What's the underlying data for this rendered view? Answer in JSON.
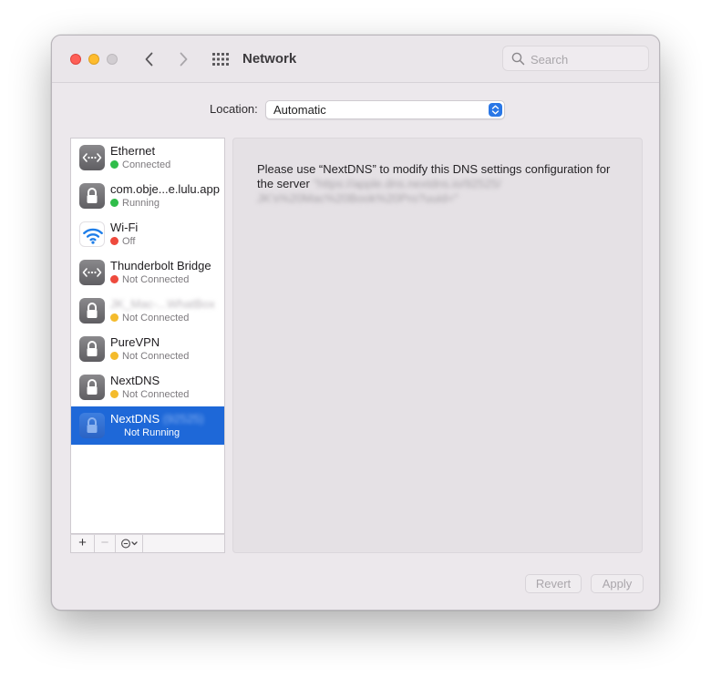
{
  "window": {
    "title": "Network"
  },
  "search": {
    "placeholder": "Search"
  },
  "location": {
    "label": "Location:",
    "value": "Automatic"
  },
  "services": [
    {
      "name": "Ethernet",
      "status": "Connected",
      "status_color": "#2fbd4a",
      "icon": "ethernet-arrows-icon"
    },
    {
      "name": "com.obje...e.lulu.app",
      "status": "Running",
      "status_color": "#2fbd4a",
      "icon": "lock-icon"
    },
    {
      "name": "Wi-Fi",
      "status": "Off",
      "status_color": "#ee4a3d",
      "icon": "wifi-icon"
    },
    {
      "name": "Thunderbolt Bridge",
      "status": "Not Connected",
      "status_color": "#ee4a3d",
      "icon": "ethernet-arrows-icon"
    },
    {
      "name": "JK_Mac-...WhatBox",
      "status": "Not Connected",
      "status_color": "#f4bb2c",
      "icon": "lock-icon",
      "blurred": true
    },
    {
      "name": "PureVPN",
      "status": "Not Connected",
      "status_color": "#f4bb2c",
      "icon": "lock-icon"
    },
    {
      "name": "NextDNS",
      "status": "Not Connected",
      "status_color": "#f4bb2c",
      "icon": "lock-icon"
    },
    {
      "name": "NextDNS",
      "name_suffix": "(92525)",
      "status": "Not Running",
      "icon": "lock-icon",
      "selected": true
    }
  ],
  "list_toolbar": {
    "add": "+",
    "remove": "−"
  },
  "detail": {
    "message_prefix": "Please use “NextDNS” to modify this DNS settings configuration for the server",
    "server_blurred_line1": "\"https://apple.dns.nextdns.io/92525/",
    "server_blurred_line2": "JK's%20Mac%20Book%20Pro?uuid=\""
  },
  "buttons": {
    "revert": "Revert",
    "apply": "Apply"
  },
  "colors": {
    "accent": "#1e68d8",
    "window_bg": "#ece8ec"
  }
}
